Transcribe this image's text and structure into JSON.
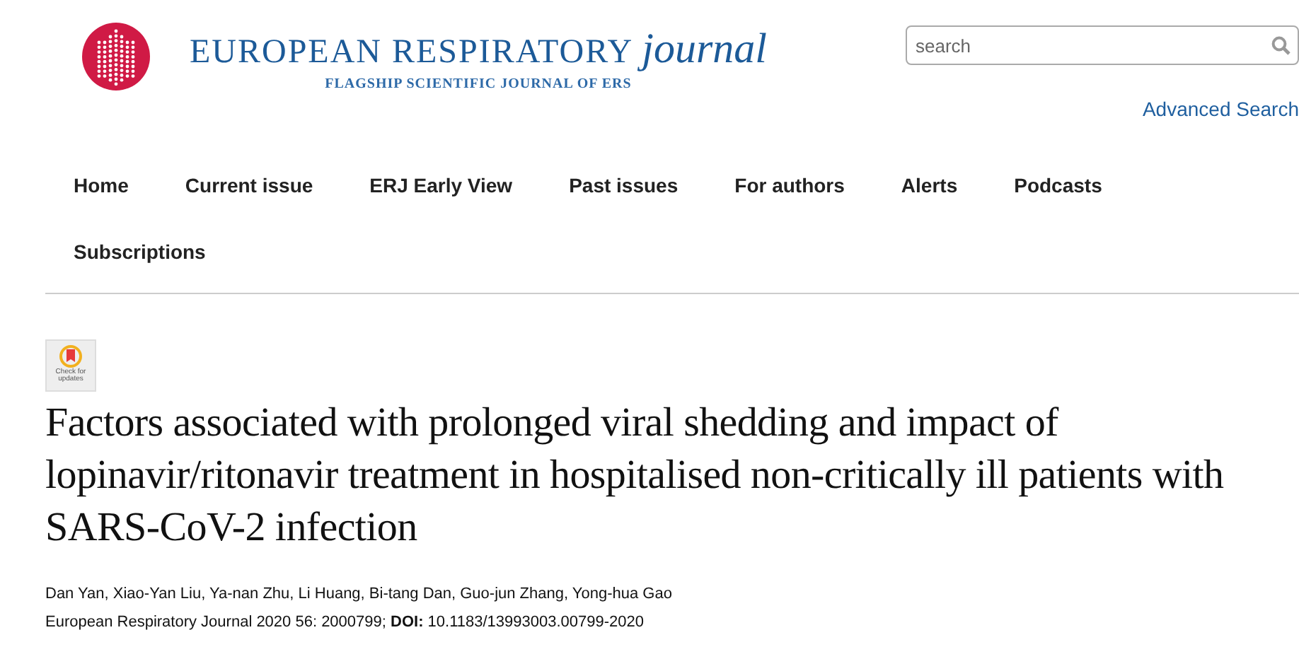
{
  "header": {
    "title": "EUROPEAN RESPIRATORY",
    "title_italic": "journal",
    "tagline": "FLAGSHIP SCIENTIFIC JOURNAL OF ERS"
  },
  "search": {
    "placeholder": "search"
  },
  "advanced_search": "Advanced Search",
  "nav": [
    {
      "label": "Home"
    },
    {
      "label": "Current issue"
    },
    {
      "label": "ERJ Early View"
    },
    {
      "label": "Past issues"
    },
    {
      "label": "For authors"
    },
    {
      "label": "Alerts"
    },
    {
      "label": "Podcasts"
    },
    {
      "label": "Subscriptions"
    }
  ],
  "badge": {
    "label": "Check for updates"
  },
  "article": {
    "title": "Factors associated with prolonged viral shedding and impact of lopinavir/ritonavir treatment in hospitalised non-critically ill patients with SARS-CoV-2 infection",
    "authors": "Dan Yan, Xiao-Yan Liu, Ya-nan Zhu, Li Huang, Bi-tang Dan, Guo-jun Zhang, Yong-hua Gao",
    "citation": "European Respiratory Journal 2020 56: 2000799; **DOI:** 10.1183/13993003.00799-2020"
  }
}
